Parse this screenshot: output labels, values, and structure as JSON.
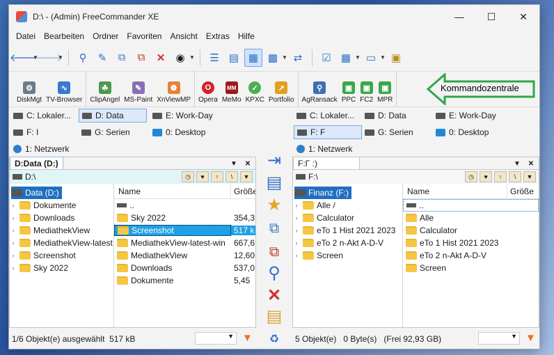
{
  "window": {
    "title": "D:\\ - (Admin) FreeCommander XE"
  },
  "menu": [
    "Datei",
    "Bearbeiten",
    "Ordner",
    "Favoriten",
    "Ansicht",
    "Extras",
    "Hilfe"
  ],
  "toolbar": {
    "icons": [
      "back-icon",
      "forward-icon",
      "search-icon",
      "edit-icon",
      "copy-icon",
      "move-icon",
      "delete-icon",
      "binoculars-icon",
      "tree-view-icon",
      "list-view-icon",
      "details-view-icon",
      "preview-icon",
      "sync-icon",
      "checklist-icon",
      "layout-icon",
      "screen-icon",
      "archive-icon"
    ]
  },
  "commands": {
    "items": [
      {
        "label": "DiskMgt",
        "icon": "disk-management-icon",
        "color": "#6b7b8c"
      },
      {
        "label": "TV-Browser",
        "icon": "tv-browser-icon",
        "color": "#3a78c9"
      },
      {
        "label": "ClipAngel",
        "icon": "clipangel-icon",
        "color": "#4c9a4c"
      },
      {
        "label": "MS-Paint",
        "icon": "paint-icon",
        "color": "#8a6fb5"
      },
      {
        "label": "XnViewMP",
        "icon": "xnview-icon",
        "color": "#e8823a"
      },
      {
        "label": "Opera",
        "icon": "opera-icon",
        "color": "#d6202b"
      },
      {
        "label": "MeMo",
        "icon": "memo-icon",
        "color": "#9b1a1a"
      },
      {
        "label": "KPXC",
        "icon": "keepassxc-icon",
        "color": "#4caf50"
      },
      {
        "label": "Portfolio",
        "icon": "portfolio-icon",
        "color": "#e0a020"
      },
      {
        "label": "AgRansack",
        "icon": "agent-ransack-icon",
        "color": "#3d6fb3"
      },
      {
        "label": "PPC",
        "icon": "ppc-icon",
        "color": "#3aa64a"
      },
      {
        "label": "FC2",
        "icon": "fc2-icon",
        "color": "#3aa64a"
      },
      {
        "label": "MPR",
        "icon": "mpr-icon",
        "color": "#3aa64a"
      }
    ],
    "callout": "Kommandozentrale",
    "callout_color": "#2ea84a"
  },
  "left": {
    "drives": [
      "C: Lokaler...",
      "D: Data",
      "E: Work-Day",
      "F: I",
      "G: Serien",
      "0: Desktop",
      "1: Netzwerk"
    ],
    "tab": "D:Data (D:)",
    "path": "D:\\",
    "tree_root": "Data (D:)",
    "tree": [
      "Dokumente",
      "Downloads",
      "MediathekView",
      "MediathekView-latest",
      "Screenshot",
      "Sky 2022"
    ],
    "col_name": "Name",
    "col_size": "Größe",
    "parent": "..",
    "files": [
      {
        "name": "Sky 2022",
        "size": "354,3"
      },
      {
        "name": "Screenshot",
        "size": "517 k"
      },
      {
        "name": "MediathekView-latest-win",
        "size": "667,6"
      },
      {
        "name": "MediathekView",
        "size": "12,60"
      },
      {
        "name": "Downloads",
        "size": "537,0"
      },
      {
        "name": "Dokumente",
        "size": "5,45"
      }
    ],
    "status": "1/6 Objekt(e) ausgewählt  517 kB"
  },
  "right": {
    "drives": [
      "C: Lokaler...",
      "D: Data",
      "E: Work-Day",
      "F: F",
      "G: Serien",
      "0: Desktop",
      "1: Netzwerk"
    ],
    "tab": "F:Γ             :)",
    "path": "F:\\",
    "tree_root": "Finanz (F:)",
    "tree": [
      "Alle /",
      "Calculator",
      "eTo 1 Hist 2021 2023",
      "eTo 2 n-Akt A-D-V",
      "Screen"
    ],
    "col_name": "Name",
    "col_size": "Größe",
    "parent": "..",
    "files": [
      {
        "name": "Alle",
        "size": ""
      },
      {
        "name": "Calculator",
        "size": ""
      },
      {
        "name": "eTo 1 Hist 2021 2023",
        "size": ""
      },
      {
        "name": "eTo 2 n-Akt A-D-V",
        "size": ""
      },
      {
        "name": "Screen",
        "size": ""
      }
    ],
    "status": "5 Objekt(e)   0 Byte(s)   (Frei 92,93 GB)"
  }
}
